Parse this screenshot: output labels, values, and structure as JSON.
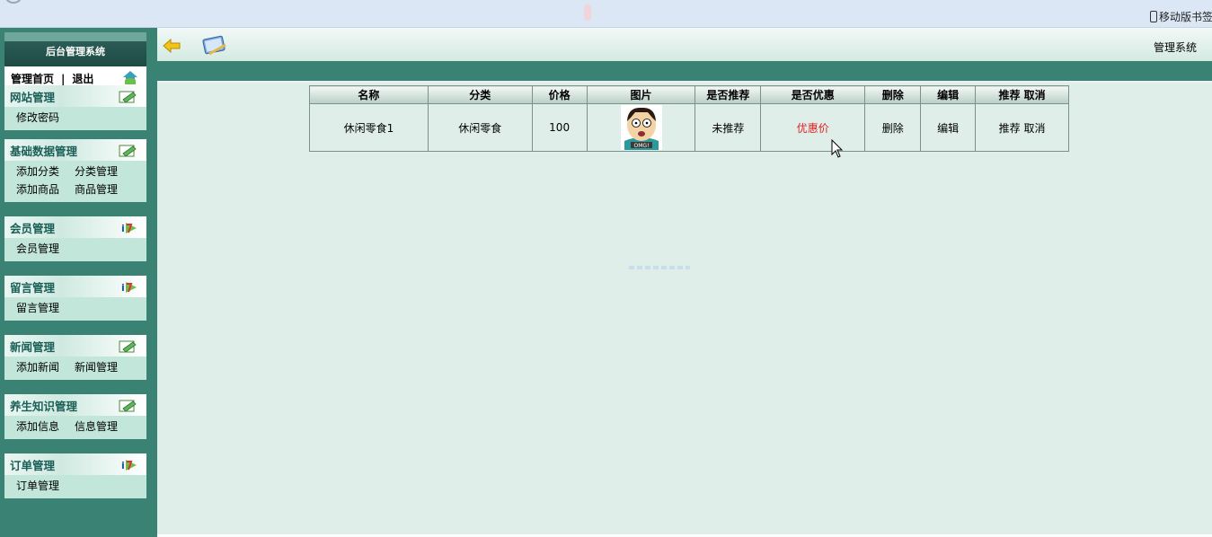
{
  "browser": {
    "mobile_bookmarks": "移动版书签"
  },
  "sidebar": {
    "header": "后台管理系统",
    "home": "管理首页",
    "separator": "|",
    "logout": "退出",
    "groups": [
      {
        "title": "网站管理",
        "icon": "edit-icon",
        "rows": [
          [
            "修改密码"
          ]
        ]
      },
      {
        "title": "基础数据管理",
        "icon": "edit-icon",
        "rows": [
          [
            "添加分类",
            "分类管理"
          ],
          [
            "添加商品",
            "商品管理"
          ]
        ]
      },
      {
        "title": "会员管理",
        "icon": "info-icon",
        "rows": [
          [
            "会员管理"
          ]
        ]
      },
      {
        "title": "留言管理",
        "icon": "info-icon",
        "rows": [
          [
            "留言管理"
          ]
        ]
      },
      {
        "title": "新闻管理",
        "icon": "edit-icon",
        "rows": [
          [
            "添加新闻",
            "新闻管理"
          ]
        ]
      },
      {
        "title": "养生知识管理",
        "icon": "edit-icon",
        "rows": [
          [
            "添加信息",
            "信息管理"
          ]
        ]
      },
      {
        "title": "订单管理",
        "icon": "info-icon",
        "rows": [
          [
            "订单管理"
          ]
        ]
      }
    ]
  },
  "toolbar": {
    "title": "管理系统"
  },
  "table": {
    "headers": [
      "名称",
      "分类",
      "价格",
      "图片",
      "是否推荐",
      "是否优惠",
      "删除",
      "编辑",
      "推荐 取消"
    ],
    "rows": [
      {
        "name": "休闲零食1",
        "category": "休闲零食",
        "price": "100",
        "image_text": "OMG!",
        "recommended": "未推荐",
        "discount": "优惠价",
        "delete": "删除",
        "edit": "编辑",
        "recommend": "推荐",
        "cancel": "取消"
      }
    ]
  },
  "colors": {
    "sidebar_bg": "#3a8274",
    "content_bg": "#dfeee9",
    "offer_text": "#e02020",
    "group_title": "#1a5f57"
  }
}
